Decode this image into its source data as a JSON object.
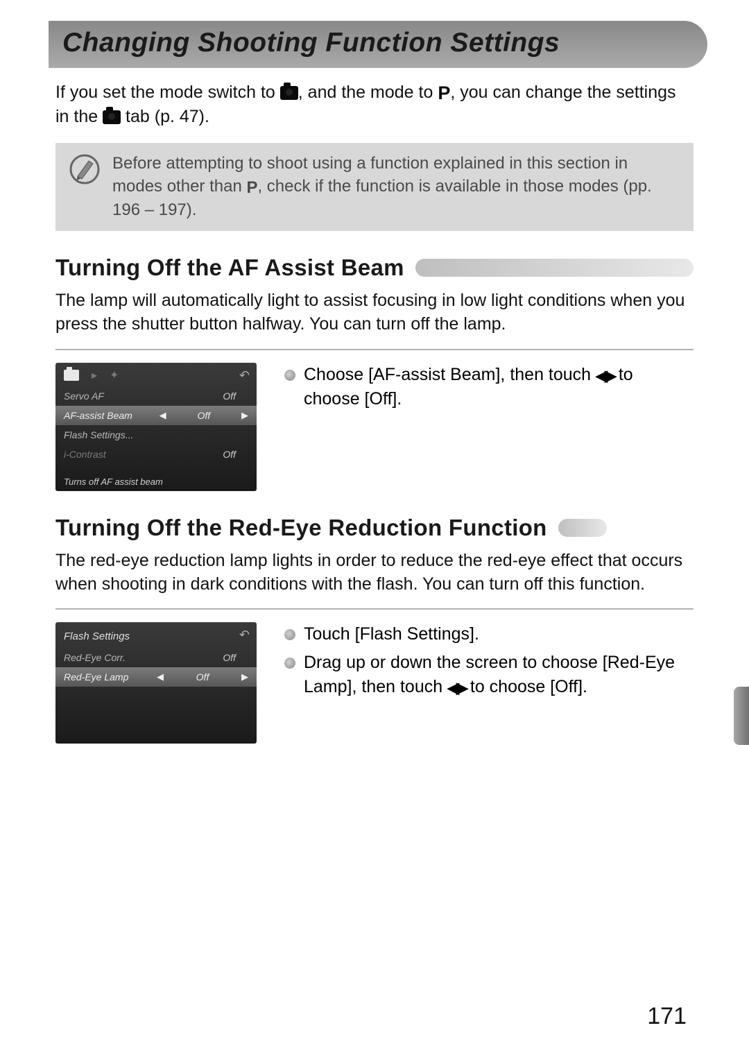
{
  "title": "Changing Shooting Function Settings",
  "intro_parts": {
    "a": "If you set the mode switch to ",
    "b": ", and the mode to ",
    "c": ", you can change the settings in the ",
    "d": " tab (p. 47)."
  },
  "note_parts": {
    "a": "Before attempting to shoot using a function explained in this section in modes other than ",
    "b": ", check if the function is available in those modes (pp. 196 – 197)."
  },
  "section1": {
    "heading": "Turning Off the AF Assist Beam",
    "body": "The lamp will automatically light to assist focusing in low light conditions when you press the shutter button halfway. You can turn off the lamp.",
    "step_parts": {
      "a": "Choose [AF-assist Beam], then touch ",
      "b": " to choose [Off]."
    },
    "screenshot": {
      "rows": [
        {
          "label": "Servo AF",
          "value": "Off"
        },
        {
          "label": "AF-assist Beam",
          "value": "Off",
          "selected": true
        },
        {
          "label": "Flash Settings...",
          "value": ""
        },
        {
          "label": "i-Contrast",
          "value": "Off"
        }
      ],
      "help": "Turns off AF assist beam"
    }
  },
  "section2": {
    "heading": "Turning Off the Red-Eye Reduction Function",
    "body": "The red-eye reduction lamp lights in order to reduce the red-eye effect that occurs when shooting in dark conditions with the flash. You can turn off this function.",
    "step1": "Touch [Flash Settings].",
    "step2_parts": {
      "a": "Drag up or down the screen to choose [Red-Eye Lamp], then touch ",
      "b": " to choose [Off]."
    },
    "screenshot": {
      "title": "Flash Settings",
      "rows": [
        {
          "label": "Red-Eye Corr.",
          "value": "Off"
        },
        {
          "label": "Red-Eye Lamp",
          "value": "Off",
          "selected": true
        }
      ]
    }
  },
  "icons": {
    "p": "P",
    "lr": "◀▶",
    "back": "↶",
    "play": "▸",
    "wrench": "✦"
  },
  "page_number": "171"
}
